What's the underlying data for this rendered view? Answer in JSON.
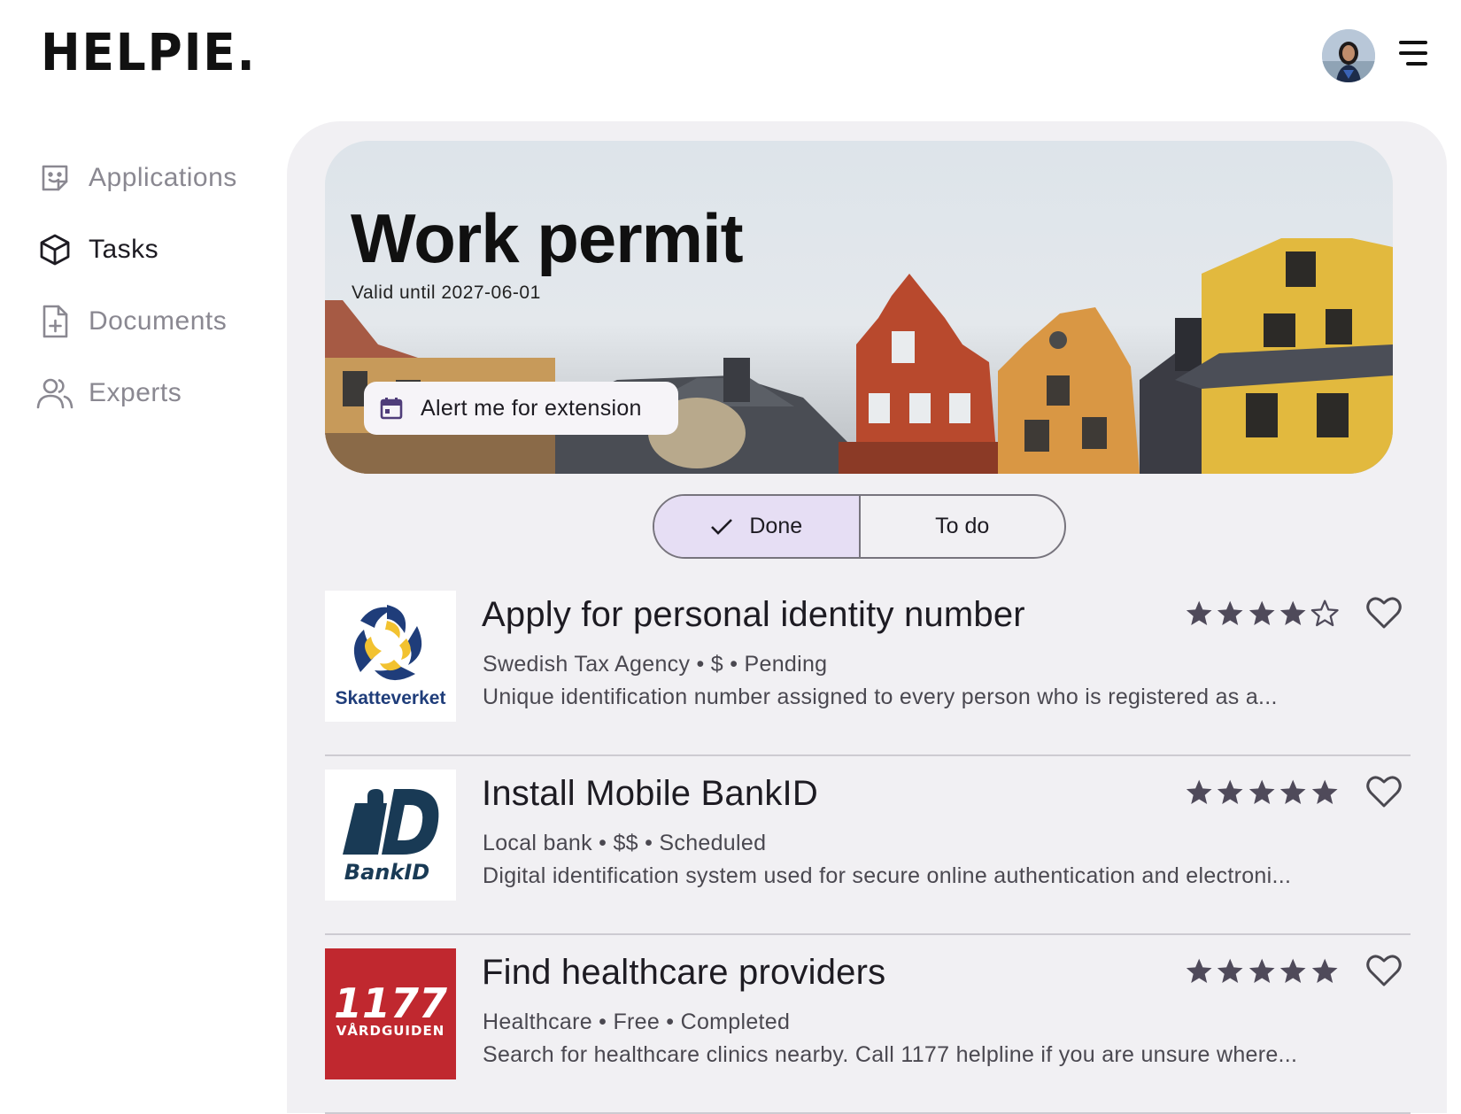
{
  "brand": {
    "logo_text": "HELPIE."
  },
  "header": {
    "avatar_alt": "user-avatar",
    "menu_icon": "hamburger-menu-icon"
  },
  "sidebar": {
    "items": [
      {
        "label": "Applications",
        "icon": "sticker-icon",
        "active": false
      },
      {
        "label": "Tasks",
        "icon": "cube-icon",
        "active": true
      },
      {
        "label": "Documents",
        "icon": "file-add-icon",
        "active": false
      },
      {
        "label": "Experts",
        "icon": "people-icon",
        "active": false
      }
    ]
  },
  "hero": {
    "title": "Work permit",
    "subtitle": "Valid until 2027-06-01",
    "action_label": "Alert me for extension",
    "action_icon": "calendar-icon"
  },
  "filter": {
    "options": [
      {
        "label": "Done",
        "selected": true,
        "icon": "check-icon"
      },
      {
        "label": "To do",
        "selected": false
      }
    ]
  },
  "tasks": [
    {
      "title": "Apply for personal identity number",
      "meta": "Swedish Tax Agency • $ • Pending",
      "description": "Unique identification number assigned to every person who is registered as a...",
      "rating": 4,
      "logo": {
        "name": "skatteverket-logo",
        "text": "Skatteverket",
        "color": "#1f3d7a"
      }
    },
    {
      "title": "Install Mobile BankID",
      "meta": "Local bank • $$ • Scheduled",
      "description": "Digital identification system used for secure online authentication and electroni...",
      "rating": 5,
      "logo": {
        "name": "bankid-logo",
        "text": "BankID",
        "color": "#193a55"
      }
    },
    {
      "title": "Find healthcare providers",
      "meta": "Healthcare • Free • Completed",
      "description": "Search for healthcare clinics nearby. Call 1177 helpline if you are unsure where...",
      "rating": 5,
      "logo": {
        "name": "1177-vardguiden-logo",
        "text": "1177",
        "subtext": "VÅRDGUIDEN",
        "color": "#c0282f"
      }
    }
  ],
  "colors": {
    "panel_bg": "#f1f0f3",
    "selected_segment": "#e6def4",
    "star": "#4f4a5a",
    "text_primary": "#1d1b22",
    "text_secondary": "#4a4850"
  }
}
